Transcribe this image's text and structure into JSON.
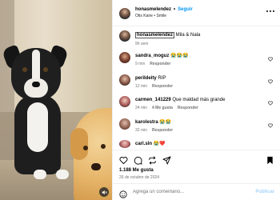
{
  "header": {
    "username": "honasmelendez",
    "separator": "•",
    "follow_label": "Seguir",
    "subtitle": "Otis Kane • Smile"
  },
  "caption": {
    "username": "honasmelendez",
    "text": " Mila & Nala",
    "time": "9h sem"
  },
  "comments": [
    {
      "username": "sandra_moguz",
      "text": "😭😭😭",
      "time": "9 min",
      "likes": "",
      "reply_label": "Responder"
    },
    {
      "username": "perildeity",
      "text": "RIP",
      "time": "12 min",
      "likes": "",
      "reply_label": "Responder"
    },
    {
      "username": "carmen_141229",
      "text": "Que maldad más grande",
      "time": "24 min",
      "likes": "4 Me gusta",
      "reply_label": "Responder"
    },
    {
      "username": "karolestra",
      "text": "😭😭",
      "time": "32 min",
      "likes": "",
      "reply_label": "Responder"
    },
    {
      "username": "carl.sln",
      "text": "😭❤️",
      "time": "",
      "likes": "",
      "reply_label": ""
    }
  ],
  "post": {
    "likes": "1.188 Me gusta",
    "date": "26 de octubre de 2024"
  },
  "composer": {
    "placeholder": "Agrega un comentario...",
    "post_label": "Publicar"
  },
  "icons": {
    "header_more": "more-horizontal-icon",
    "comment_like": "heart-outline-icon",
    "actions": [
      "heart-icon",
      "comment-icon",
      "repost-icon",
      "share-icon",
      "save-icon"
    ],
    "composer": "emoji-icon",
    "media": "speaker-muted-icon"
  },
  "colors": {
    "accent": "#0095f6",
    "secondary_text": "#737373",
    "divider": "#efefef",
    "post_disabled": "#a8d4f8"
  }
}
